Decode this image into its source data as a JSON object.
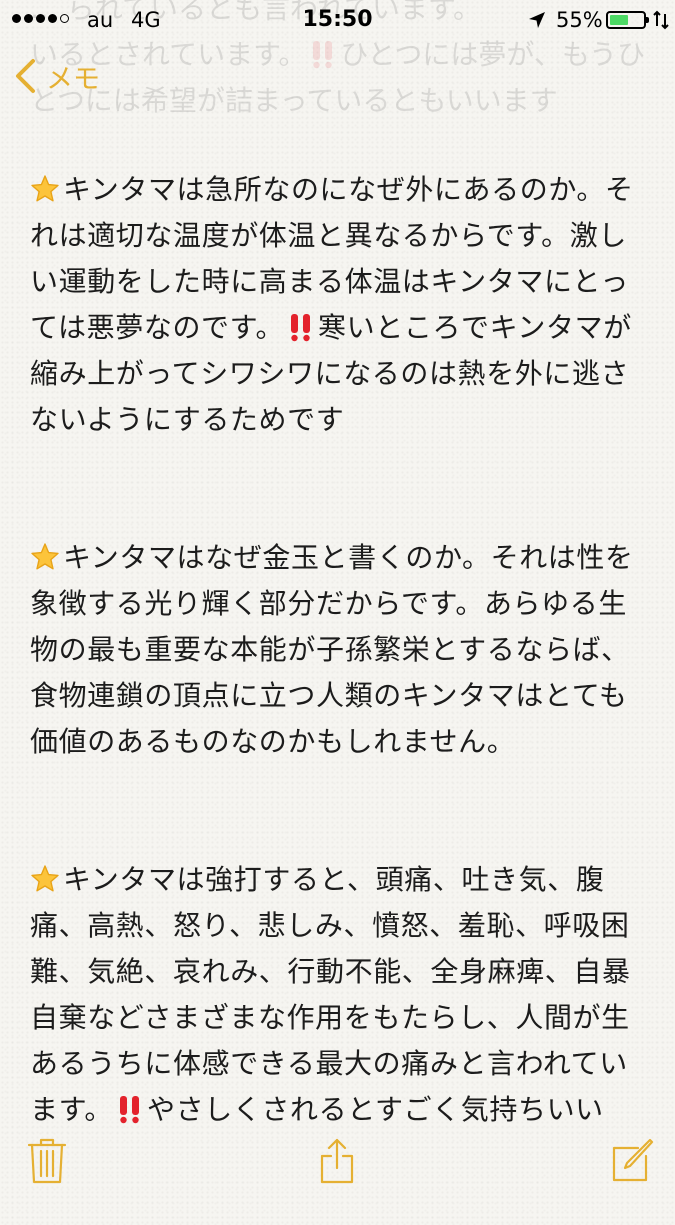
{
  "status_bar": {
    "carrier": "au",
    "network": "4G",
    "time": "15:50",
    "battery_percent": "55%",
    "battery_level": 0.55,
    "signal_bars_filled": 4,
    "signal_bars_total": 5,
    "icons": [
      "location-arrow-icon",
      "battery-icon",
      "charging-icon"
    ],
    "battery_color": "#4cd964"
  },
  "nav": {
    "back_label": "メモ",
    "back_icon": "chevron-left-icon",
    "accent_color": "#e5b032"
  },
  "note": {
    "scrolled_ghost_lines": [
      "… られているとも言われています。",
      "いるとされています。‼️ひとつには夢が、もうひ",
      "とつには希望が詰まっているともいいます"
    ],
    "paragraphs": [
      {
        "lines": [
          "キンタマは急所なのになぜ外にあるのか。そ",
          "れは適切な温度が体温と異なるからです。激し",
          "い運動をした時に高まる体温はキンタマにとっ",
          "ては悪夢なのです。‼️寒いところでキンタマが",
          "縮み上がってシワシワになるのは熱を外に逃さ",
          "ないようにするためです"
        ]
      },
      {
        "lines": [
          "キンタマはなぜ金玉と書くのか。それは性を",
          "象徴する光り輝く部分だからです。あらゆる生",
          "物の最も重要な本能が子孫繁栄とするならば、",
          "食物連鎖の頂点に立つ人類のキンタマはとても",
          "価値のあるものなのかもしれません。"
        ]
      },
      {
        "lines": [
          "キンタマは強打すると、頭痛、吐き気、腹",
          "痛、高熱、怒り、悲しみ、憤怒、羞恥、呼吸困",
          "難、気絶、哀れみ、行動不能、全身麻痺、自暴",
          "自棄などさまざまな作用をもたらし、人間が生",
          "あるうちに体感できる最大の痛みと言われてい",
          "ます。‼️やさしくされるとすごく気持ちいい"
        ]
      }
    ]
  },
  "toolbar": {
    "items": [
      "trash-icon",
      "share-icon",
      "compose-icon"
    ],
    "color": "#e5b032"
  }
}
